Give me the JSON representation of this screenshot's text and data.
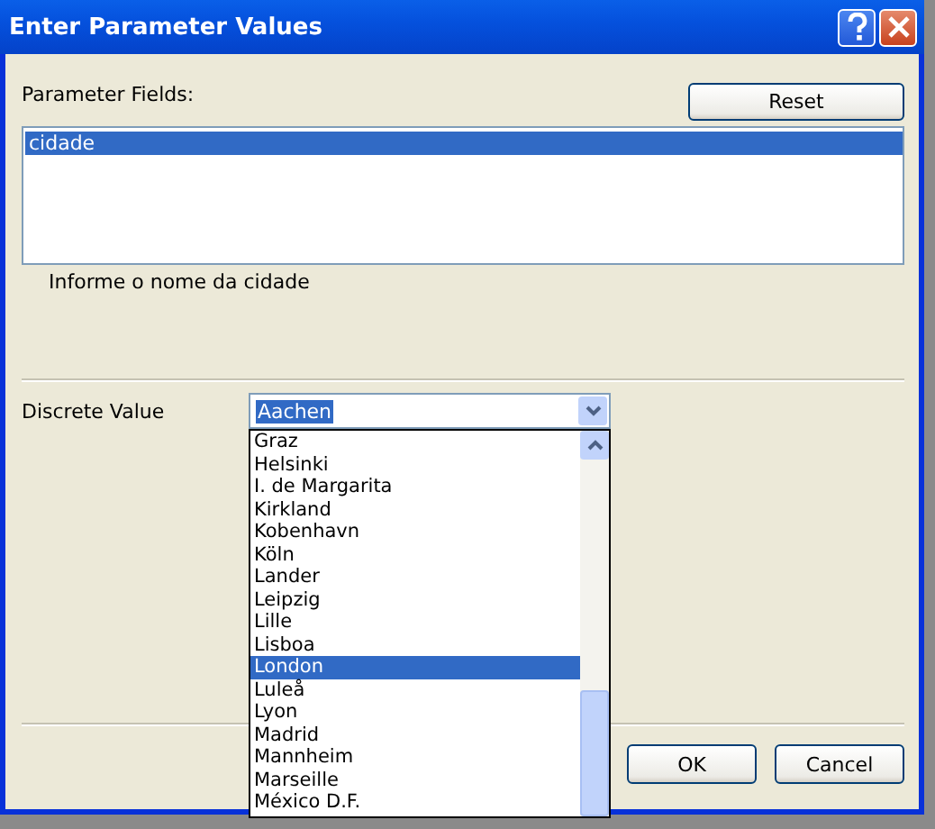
{
  "window": {
    "title": "Enter Parameter Values"
  },
  "parameter_fields": {
    "label": "Parameter Fields:",
    "items": [
      {
        "label": "cidade",
        "selected": true
      }
    ],
    "description": "Informe o nome da cidade"
  },
  "reset_button": "Reset",
  "discrete_value": {
    "label": "Discrete Value",
    "value": "Aachen",
    "expanded": true,
    "options": [
      {
        "label": "Graz",
        "selected": false
      },
      {
        "label": "Helsinki",
        "selected": false
      },
      {
        "label": "I. de Margarita",
        "selected": false
      },
      {
        "label": "Kirkland",
        "selected": false
      },
      {
        "label": "Kobenhavn",
        "selected": false
      },
      {
        "label": "Köln",
        "selected": false
      },
      {
        "label": "Lander",
        "selected": false
      },
      {
        "label": "Leipzig",
        "selected": false
      },
      {
        "label": "Lille",
        "selected": false
      },
      {
        "label": "Lisboa",
        "selected": false
      },
      {
        "label": "London",
        "selected": true
      },
      {
        "label": "Luleå",
        "selected": false
      },
      {
        "label": "Lyon",
        "selected": false
      },
      {
        "label": "Madrid",
        "selected": false
      },
      {
        "label": "Mannheim",
        "selected": false
      },
      {
        "label": "Marseille",
        "selected": false
      },
      {
        "label": "México D.F.",
        "selected": false
      }
    ]
  },
  "buttons": [
    "OK",
    "Cancel"
  ]
}
